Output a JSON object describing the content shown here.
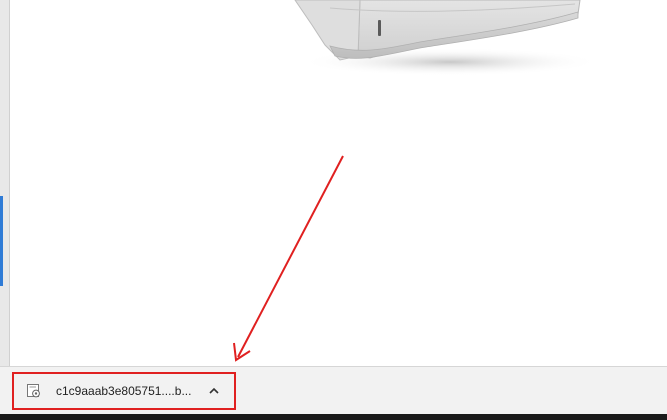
{
  "download_bar": {
    "file_name": "c1c9aaab3e805751....b...",
    "file_icon": "document-gear-icon",
    "expand_icon": "chevron-up-icon"
  },
  "annotation": {
    "color": "#e02020",
    "type": "arrow"
  },
  "colors": {
    "bar_background": "#f2f2f2",
    "highlight_border": "#e02020",
    "accent": "#2f7bd6"
  }
}
